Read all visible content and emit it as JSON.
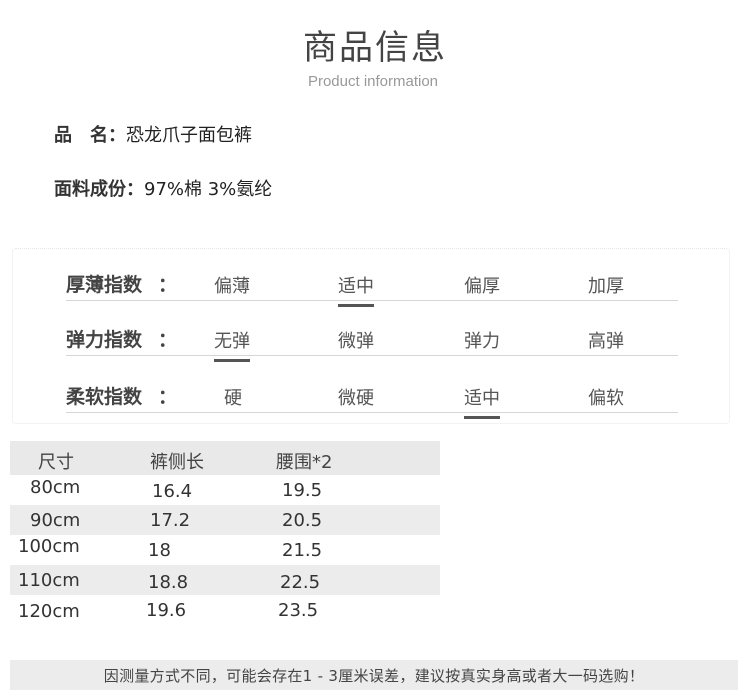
{
  "header": {
    "title": "商品信息",
    "subtitle": "Product information"
  },
  "info": {
    "name_label": "品　名：",
    "name_value": "恐龙爪子面包裤",
    "fabric_label": "面料成份：",
    "fabric_value": "97%棉 3%氨纶"
  },
  "attributes": [
    {
      "label": "厚薄指数",
      "colon": "：",
      "options": [
        "偏薄",
        "适中",
        "偏厚",
        "加厚"
      ],
      "selected": "适中"
    },
    {
      "label": "弹力指数",
      "colon": "：",
      "options": [
        "无弹",
        "微弹",
        "弹力",
        "高弹"
      ],
      "selected": "无弹"
    },
    {
      "label": "柔软指数",
      "colon": "：",
      "options": [
        "硬",
        "微硬",
        "适中",
        "偏软"
      ],
      "selected": "适中"
    }
  ],
  "size_table": {
    "headers": [
      "尺寸",
      "裤侧长",
      "腰围*2"
    ],
    "rows": [
      [
        "80cm",
        "16.4",
        "19.5"
      ],
      [
        "90cm",
        "17.2",
        "20.5"
      ],
      [
        "100cm",
        "18",
        "21.5"
      ],
      [
        "110cm",
        "18.8",
        "22.5"
      ],
      [
        "120cm",
        "19.6",
        "23.5"
      ]
    ]
  },
  "note": "因测量方式不同，可能会存在1 - 3厘米误差，建议按真实身高或者大一码选购！"
}
